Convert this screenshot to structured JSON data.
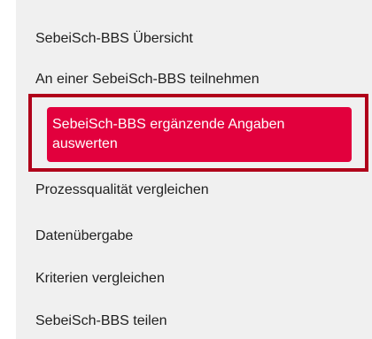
{
  "colors": {
    "panel_background": "#f0f0f0",
    "active_background": "#e2003d",
    "highlight_border": "#b0001a",
    "text": "#1f1f1f",
    "active_text": "#ffffff"
  },
  "menu": {
    "items": [
      {
        "label": "SebeiSch-BBS Übersicht",
        "active": false
      },
      {
        "label": "An einer SebeiSch-BBS teilnehmen",
        "active": false
      },
      {
        "label": "SebeiSch-BBS ergänzende Angaben auswerten",
        "active": true
      },
      {
        "label": "Prozessqualität vergleichen",
        "active": false
      },
      {
        "label": "Datenübergabe",
        "active": false
      },
      {
        "label": "Kriterien vergleichen",
        "active": false
      },
      {
        "label": "SebeiSch-BBS teilen",
        "active": false
      }
    ]
  }
}
